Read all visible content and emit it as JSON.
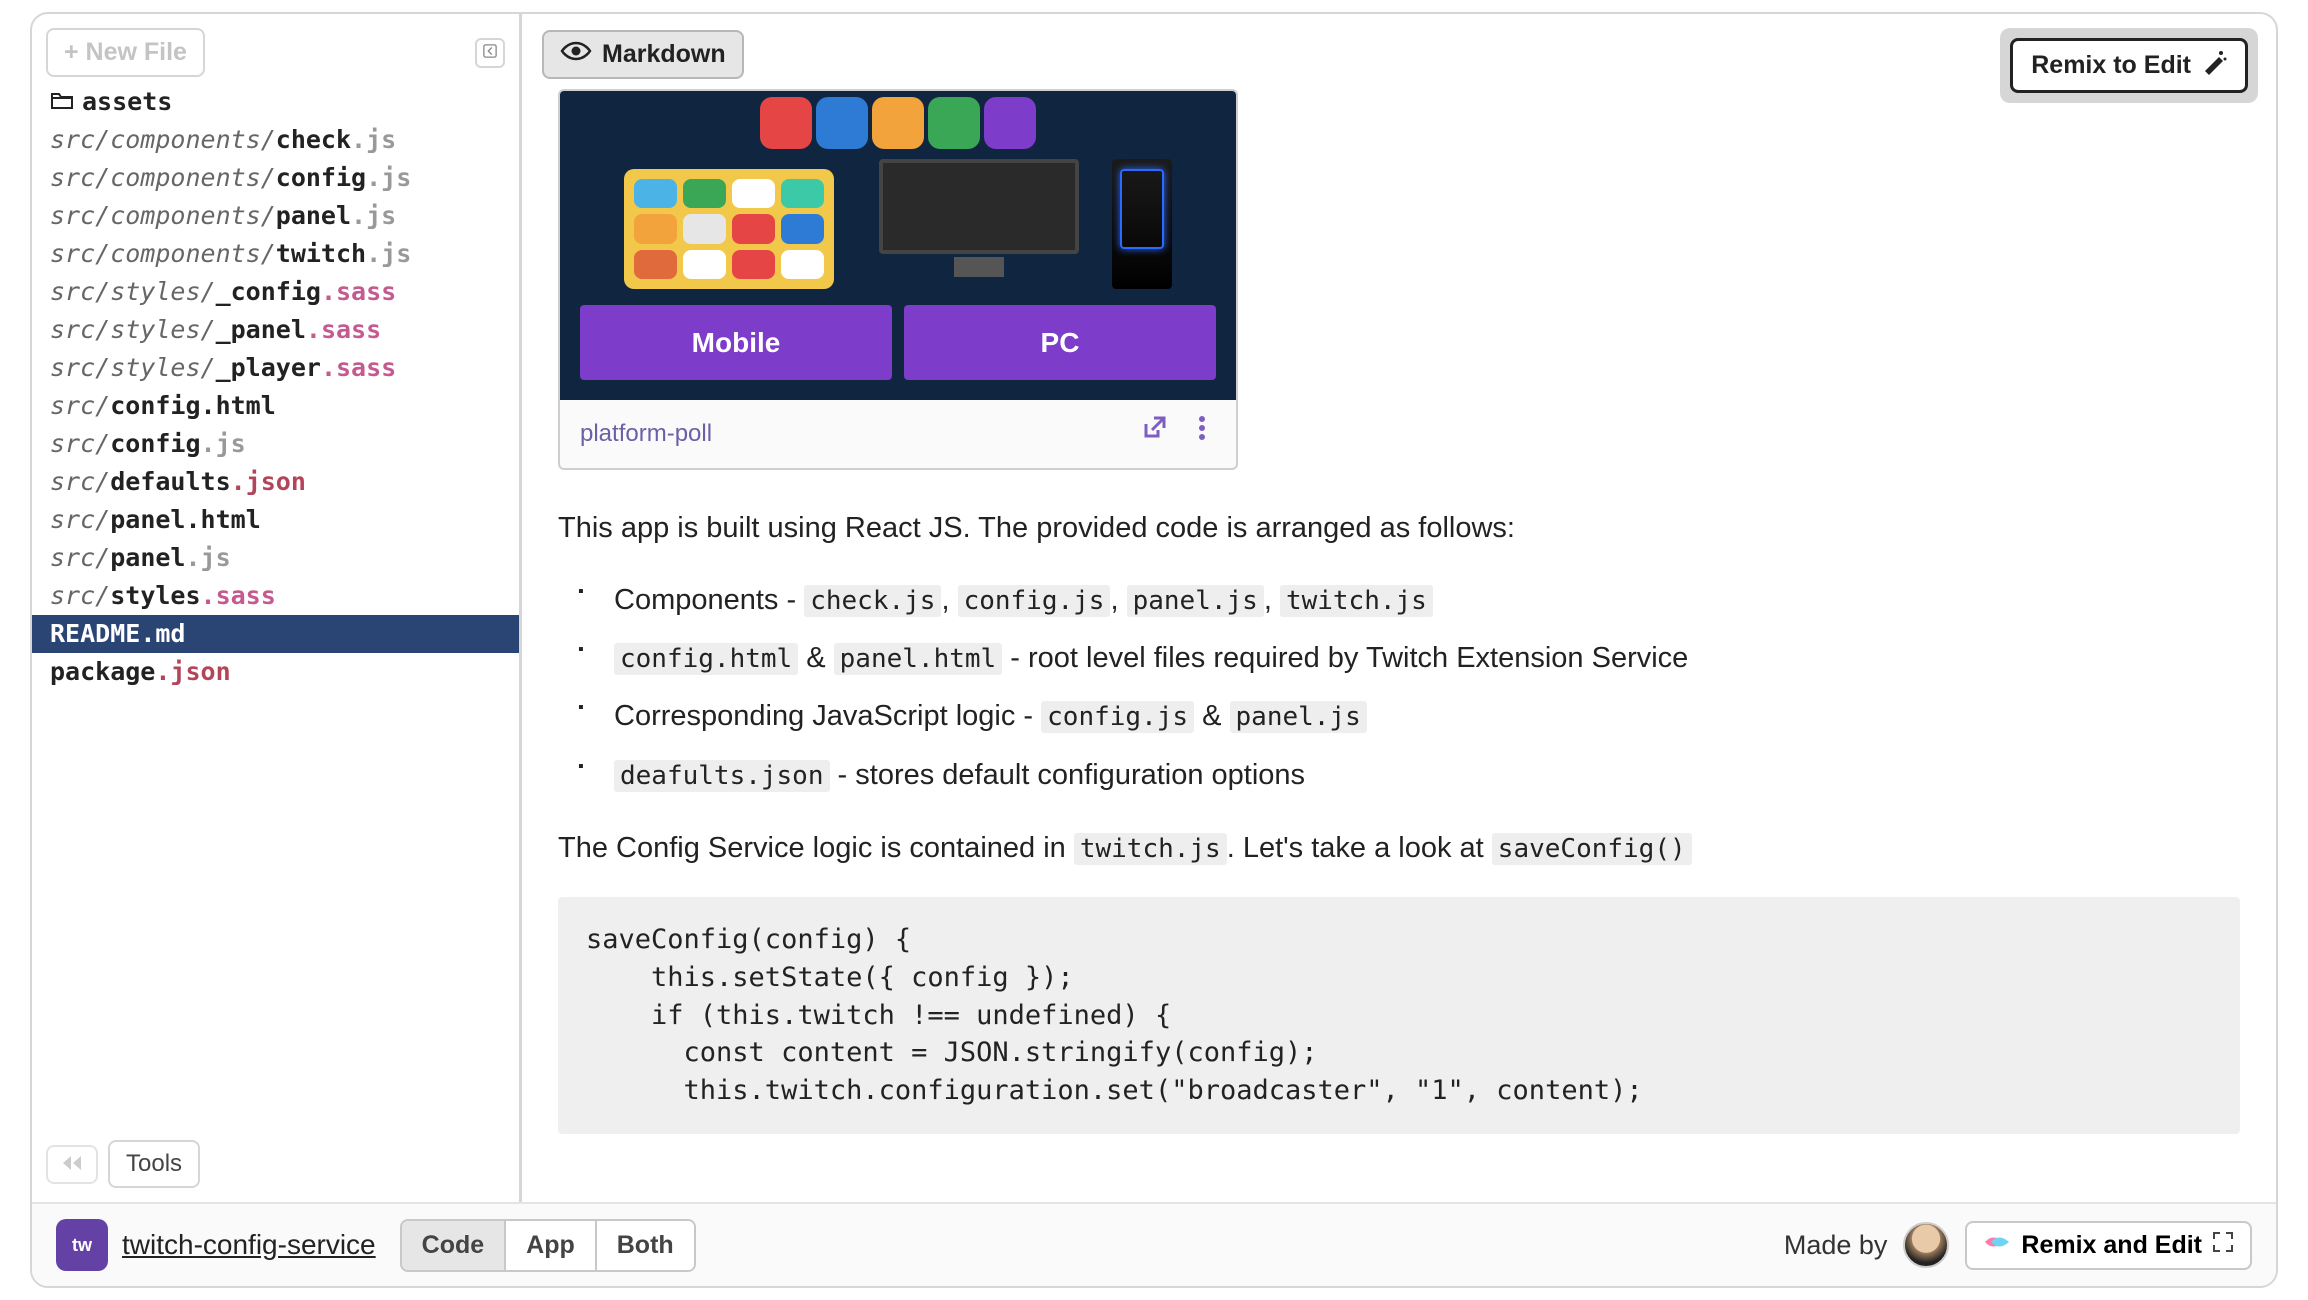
{
  "sidebar": {
    "new_file_label": "+ New File",
    "tools_label": "Tools",
    "folder": {
      "name": "assets"
    },
    "files": [
      {
        "path": "src/components/",
        "name": "check",
        "ext": ".js",
        "extClass": "ext-js"
      },
      {
        "path": "src/components/",
        "name": "config",
        "ext": ".js",
        "extClass": "ext-js"
      },
      {
        "path": "src/components/",
        "name": "panel",
        "ext": ".js",
        "extClass": "ext-js"
      },
      {
        "path": "src/components/",
        "name": "twitch",
        "ext": ".js",
        "extClass": "ext-js"
      },
      {
        "path": "src/styles/",
        "name": "_config",
        "ext": ".sass",
        "extClass": "ext-sass"
      },
      {
        "path": "src/styles/",
        "name": "_panel",
        "ext": ".sass",
        "extClass": "ext-sass"
      },
      {
        "path": "src/styles/",
        "name": "_player",
        "ext": ".sass",
        "extClass": "ext-sass"
      },
      {
        "path": "src/",
        "name": "config",
        "ext": ".html",
        "extClass": "ext-html"
      },
      {
        "path": "src/",
        "name": "config",
        "ext": ".js",
        "extClass": "ext-js"
      },
      {
        "path": "src/",
        "name": "defaults",
        "ext": ".json",
        "extClass": "ext-json"
      },
      {
        "path": "src/",
        "name": "panel",
        "ext": ".html",
        "extClass": "ext-html"
      },
      {
        "path": "src/",
        "name": "panel",
        "ext": ".js",
        "extClass": "ext-js"
      },
      {
        "path": "src/",
        "name": "styles",
        "ext": ".sass",
        "extClass": "ext-sass"
      },
      {
        "path": "",
        "name": "README",
        "ext": ".md",
        "extClass": "ext-md",
        "active": true
      },
      {
        "path": "",
        "name": "package",
        "ext": ".json",
        "extClass": "ext-json"
      }
    ]
  },
  "header": {
    "markdown_label": "Markdown",
    "remix_label": "Remix to Edit"
  },
  "poll": {
    "mobile_label": "Mobile",
    "pc_label": "PC",
    "footer_label": "platform-poll"
  },
  "doc": {
    "p1": "This app is built using React JS. The provided code is arranged as follows:",
    "li1_pre": "Components - ",
    "li1_codes": [
      "check.js",
      "config.js",
      "panel.js",
      "twitch.js"
    ],
    "li2_codes": [
      "config.html",
      "panel.html"
    ],
    "li2_mid": " & ",
    "li2_post": " - root level files required by Twitch Extension Service",
    "li3_pre": "Corresponding JavaScript logic - ",
    "li3_codes": [
      "config.js",
      "panel.js"
    ],
    "li3_mid": " & ",
    "li4_code": "deafults.json",
    "li4_post": " - stores default configuration options",
    "p2_pre": "The Config Service logic is contained in ",
    "p2_code1": "twitch.js",
    "p2_mid": ". Let's take a look at ",
    "p2_code2": "saveConfig()",
    "code_block": "saveConfig(config) {\n    this.setState({ config });\n    if (this.twitch !== undefined) {\n      const content = JSON.stringify(config);\n      this.twitch.configuration.set(\"broadcaster\", \"1\", content);"
  },
  "footer": {
    "project_name": "twitch-config-service",
    "tabs": [
      "Code",
      "App",
      "Both"
    ],
    "active_tab": "Code",
    "made_by": "Made by",
    "remix_edit": "Remix and Edit"
  },
  "colors": {
    "accent": "#7d3cc9",
    "active_file": "#2a4473"
  }
}
